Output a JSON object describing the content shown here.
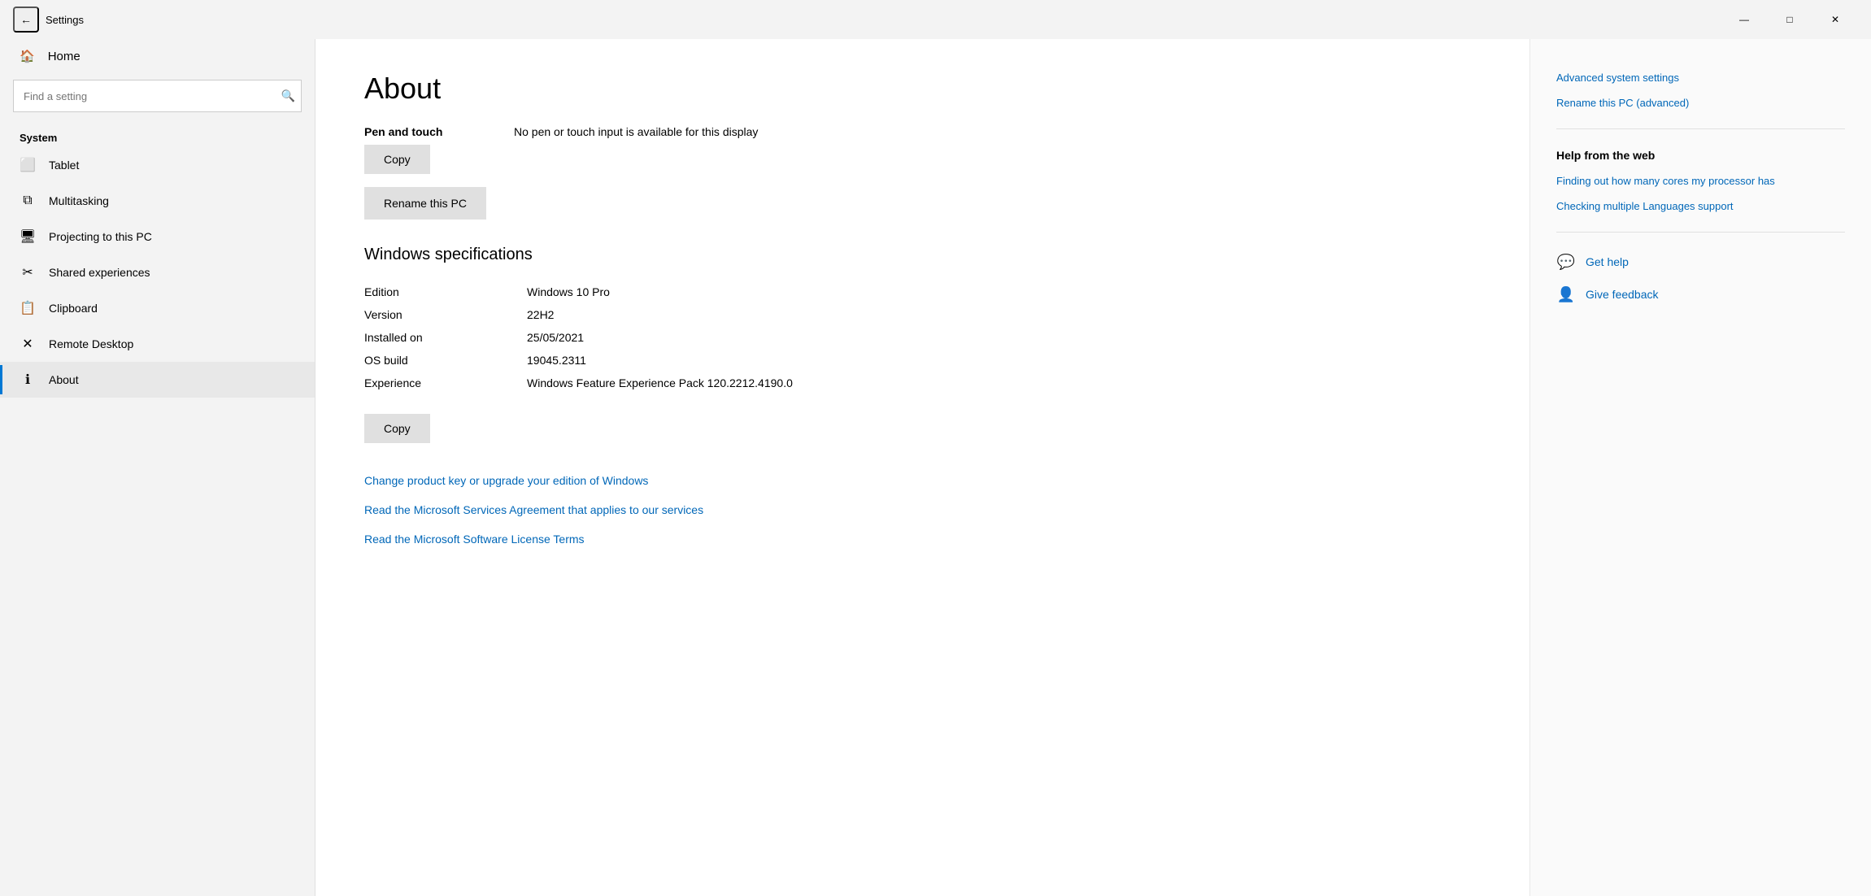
{
  "titleBar": {
    "backLabel": "←",
    "title": "Settings",
    "minimizeLabel": "—",
    "maximizeLabel": "□",
    "closeLabel": "✕"
  },
  "sidebar": {
    "homeLabel": "Home",
    "searchPlaceholder": "Find a setting",
    "sectionLabel": "System",
    "items": [
      {
        "id": "tablet",
        "label": "Tablet",
        "icon": "⬜"
      },
      {
        "id": "multitasking",
        "label": "Multitasking",
        "icon": "⧉"
      },
      {
        "id": "projecting",
        "label": "Projecting to this PC",
        "icon": "🖥"
      },
      {
        "id": "shared-experiences",
        "label": "Shared experiences",
        "icon": "✂"
      },
      {
        "id": "clipboard",
        "label": "Clipboard",
        "icon": "📋"
      },
      {
        "id": "remote-desktop",
        "label": "Remote Desktop",
        "icon": "✕"
      },
      {
        "id": "about",
        "label": "About",
        "icon": "ℹ"
      }
    ]
  },
  "main": {
    "pageTitle": "About",
    "penTouchLabel": "Pen and touch",
    "penTouchValue": "No pen or touch input is available for this display",
    "copyButton1": "Copy",
    "renameButton": "Rename this PC",
    "windowsSpecTitle": "Windows specifications",
    "specs": [
      {
        "label": "Edition",
        "value": "Windows 10 Pro"
      },
      {
        "label": "Version",
        "value": "22H2"
      },
      {
        "label": "Installed on",
        "value": "25/05/2021"
      },
      {
        "label": "OS build",
        "value": "19045.2311"
      },
      {
        "label": "Experience",
        "value": "Windows Feature Experience Pack 120.2212.4190.0"
      }
    ],
    "copyButton2": "Copy",
    "links": [
      {
        "id": "change-product-key",
        "label": "Change product key or upgrade your edition of Windows"
      },
      {
        "id": "microsoft-services",
        "label": "Read the Microsoft Services Agreement that applies to our services"
      },
      {
        "id": "software-license",
        "label": "Read the Microsoft Software License Terms"
      }
    ]
  },
  "rightPanel": {
    "links": [
      {
        "id": "advanced-system",
        "label": "Advanced system settings"
      },
      {
        "id": "rename-advanced",
        "label": "Rename this PC (advanced)"
      }
    ],
    "helpTitle": "Help from the web",
    "helpLinks": [
      {
        "id": "cores-link",
        "label": "Finding out how many cores my processor has"
      },
      {
        "id": "languages-link",
        "label": "Checking multiple Languages support"
      }
    ],
    "actions": [
      {
        "id": "get-help",
        "label": "Get help",
        "icon": "💬"
      },
      {
        "id": "give-feedback",
        "label": "Give feedback",
        "icon": "👤"
      }
    ]
  }
}
